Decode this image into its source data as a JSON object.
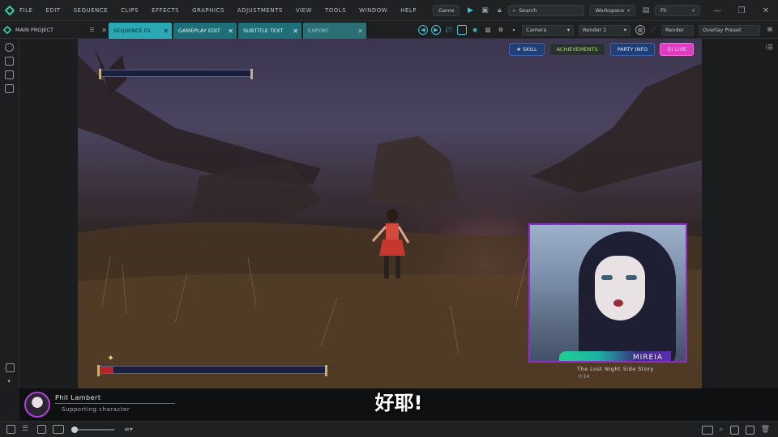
{
  "menubar": {
    "items": [
      "FILE",
      "EDIT",
      "SEQUENCE",
      "CLIPS",
      "EFFECTS",
      "GRAPHICS",
      "ADJUSTMENTS",
      "VIEW",
      "TOOLS",
      "WINDOW",
      "HELP"
    ],
    "mode_label": "Game",
    "search_placeholder": "Search",
    "layout_select": "Workspace",
    "zoom_select": "Fit"
  },
  "toolbar2": {
    "project_name": "MAIN PROJECT",
    "tabs": [
      {
        "label": "SEQUENCE 01",
        "state": "active"
      },
      {
        "label": "GAMEPLAY EDIT",
        "state": "normal"
      },
      {
        "label": "SUBTITLE TEXT",
        "state": "normal"
      },
      {
        "label": "EXPORT",
        "state": "dim"
      }
    ],
    "select_a": "Camera",
    "select_b": "Render 1",
    "render_label": "Render",
    "overlay_label": "Overlay Preset"
  },
  "hud": {
    "pill_1": "★ SKILL",
    "pill_2": "ACHIEVEMENTS",
    "pill_3": "PARTY INFO",
    "pill_4": "((( LIVE",
    "player_health_percent": 6
  },
  "pip": {
    "name_tag": "MIREIA",
    "subtitle_line": "The Lost Night Side Story",
    "subtitle_small": "0:14"
  },
  "caption": {
    "speaker": "Phil Lambert",
    "speaker_sub": "Supporting character",
    "text": "好耶!"
  },
  "colors": {
    "accent_teal": "#2aa9b5",
    "pip_border": "#8e2ed0",
    "live_pink": "#e13ac3"
  }
}
